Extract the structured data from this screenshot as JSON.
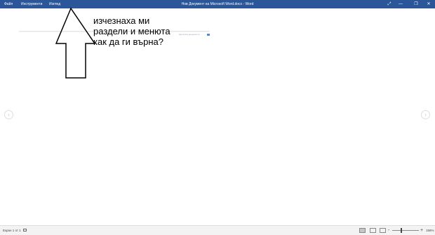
{
  "titlebar": {
    "menu": [
      "Файл",
      "Инструменти",
      "Изглед"
    ],
    "title": "Нов Документ на Microsoft Word.docx  -  Word",
    "controls": {
      "fullscreen": "⤢",
      "minimize": "—",
      "restore": "❐",
      "close": "✕"
    },
    "bg_color": "#2b579a"
  },
  "document": {
    "tag_text": "Щтой без рецерзисти"
  },
  "annotation": {
    "text": "изчезнаха ми\nраздели и менюта\nкак да ги върна?"
  },
  "nav": {
    "prev": "‹",
    "next": "›"
  },
  "statusbar": {
    "pages": "Екран 1 от 1",
    "zoom": {
      "minus": "-",
      "plus": "+",
      "value": "156%",
      "level_percent": 156
    }
  }
}
